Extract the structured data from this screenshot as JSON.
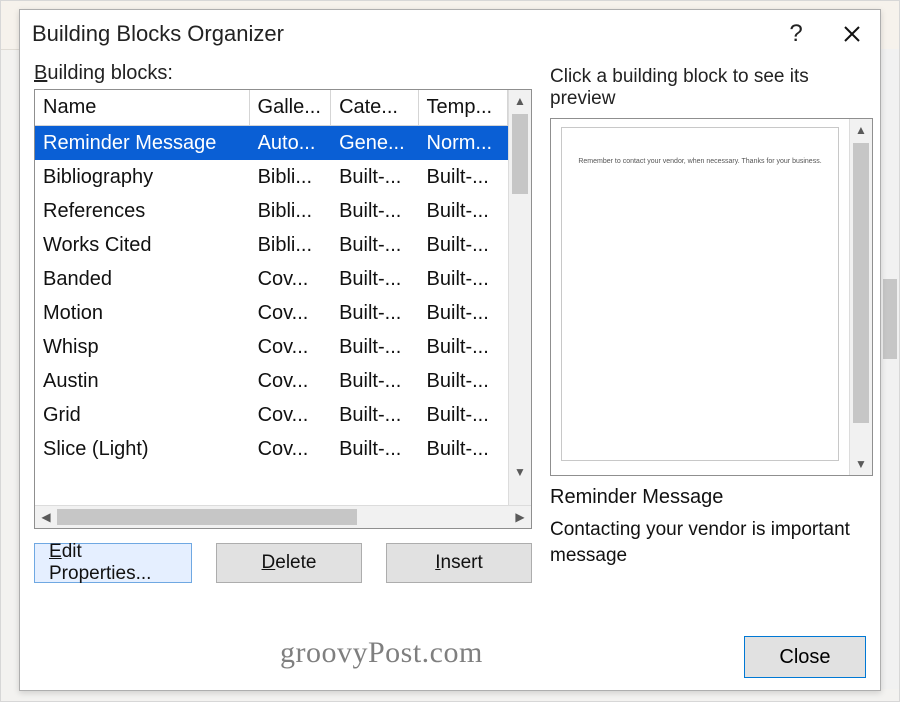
{
  "dialog": {
    "title": "Building Blocks Organizer",
    "help_aria": "Help",
    "close_aria": "Close"
  },
  "left": {
    "label_prefix": "B",
    "label_rest": "uilding blocks:",
    "columns": {
      "name": "Name",
      "gallery": "Galle...",
      "category": "Cate...",
      "template": "Temp..."
    },
    "rows": [
      {
        "name": "Reminder Message",
        "gallery": "Auto...",
        "category": "Gene...",
        "template": "Norm...",
        "selected": true
      },
      {
        "name": "Bibliography",
        "gallery": "Bibli...",
        "category": "Built-...",
        "template": "Built-...",
        "selected": false
      },
      {
        "name": "References",
        "gallery": "Bibli...",
        "category": "Built-...",
        "template": "Built-...",
        "selected": false
      },
      {
        "name": "Works Cited",
        "gallery": "Bibli...",
        "category": "Built-...",
        "template": "Built-...",
        "selected": false
      },
      {
        "name": "Banded",
        "gallery": "Cov...",
        "category": "Built-...",
        "template": "Built-...",
        "selected": false
      },
      {
        "name": "Motion",
        "gallery": "Cov...",
        "category": "Built-...",
        "template": "Built-...",
        "selected": false
      },
      {
        "name": "Whisp",
        "gallery": "Cov...",
        "category": "Built-...",
        "template": "Built-...",
        "selected": false
      },
      {
        "name": "Austin",
        "gallery": "Cov...",
        "category": "Built-...",
        "template": "Built-...",
        "selected": false
      },
      {
        "name": "Grid",
        "gallery": "Cov...",
        "category": "Built-...",
        "template": "Built-...",
        "selected": false
      },
      {
        "name": "Slice (Light)",
        "gallery": "Cov...",
        "category": "Built-...",
        "template": "Built-...",
        "selected": false
      }
    ]
  },
  "right": {
    "hint": "Click a building block to see its preview",
    "preview_text": "Remember to contact your vendor, when necessary. Thanks for your business.",
    "preview_name": "Reminder Message",
    "preview_desc": "Contacting your vendor is important message"
  },
  "buttons": {
    "edit_prefix": "E",
    "edit_rest": "dit Properties...",
    "delete_prefix": "D",
    "delete_rest": "elete",
    "insert_prefix": "I",
    "insert_rest": "nsert",
    "close": "Close"
  },
  "watermark": "groovyPost.com"
}
